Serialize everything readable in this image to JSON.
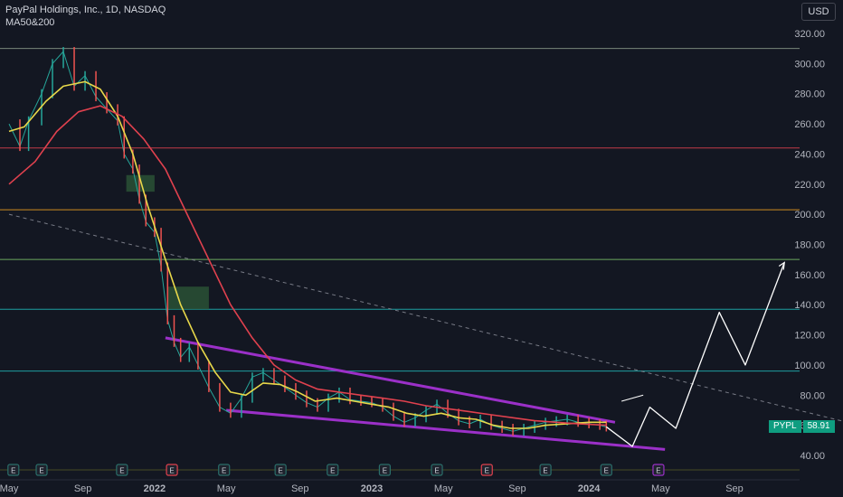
{
  "header": {
    "title": "PayPal Holdings, Inc., 1D, NASDAQ",
    "indicator": "MA50&200"
  },
  "currency_label": "USD",
  "price_badge": {
    "symbol": "PYPL",
    "value": "58.91"
  },
  "colors": {
    "background": "#131722",
    "grid_text": "#b2b5be",
    "ma50": "#e8d84a",
    "ma200": "#e0414e",
    "channel": "#9b30c8",
    "up": "#26a69a",
    "down": "#ef5350",
    "projection": "#ffffff",
    "badge": "#0f9d80"
  },
  "chart_data": {
    "type": "line",
    "title": "PayPal Holdings, Inc., 1D, NASDAQ",
    "subtitle": "MA50&200",
    "y_axis": {
      "ticks": [
        320,
        300,
        280,
        260,
        240,
        220,
        200,
        180,
        160,
        140,
        120,
        100,
        80,
        60,
        40
      ],
      "range": [
        30,
        330
      ]
    },
    "x_axis": {
      "range": [
        2020.38,
        2025.0
      ],
      "ticks": [
        {
          "label": "May",
          "x": 2020.33
        },
        {
          "label": "Sep",
          "x": 2020.67
        },
        {
          "label": "2022",
          "x": 2021.0
        },
        {
          "label": "May",
          "x": 2021.33
        },
        {
          "label": "Sep",
          "x": 2021.67
        },
        {
          "label": "2023",
          "x": 2022.0
        },
        {
          "label": "May",
          "x": 2022.33
        },
        {
          "label": "Sep",
          "x": 2022.67
        },
        {
          "label": "2024",
          "x": 2023.0
        },
        {
          "label": "May",
          "x": 2023.33
        },
        {
          "label": "Sep",
          "x": 2023.67
        }
      ]
    },
    "horizontal_levels": [
      {
        "value": 310,
        "color": "#8a9a8a"
      },
      {
        "value": 244,
        "color": "#e0414e"
      },
      {
        "value": 203,
        "color": "#f0a020"
      },
      {
        "value": 170,
        "color": "#7bc26a"
      },
      {
        "value": 137,
        "color": "#1fb5b5"
      },
      {
        "value": 96,
        "color": "#1fb5b5"
      }
    ],
    "series": [
      {
        "kind": "price",
        "points": [
          [
            2020.33,
            260
          ],
          [
            2020.38,
            245
          ],
          [
            2020.42,
            262
          ],
          [
            2020.48,
            280
          ],
          [
            2020.53,
            300
          ],
          [
            2020.58,
            308
          ],
          [
            2020.63,
            285
          ],
          [
            2020.68,
            292
          ],
          [
            2020.73,
            278
          ],
          [
            2020.78,
            270
          ],
          [
            2020.83,
            262
          ],
          [
            2020.86,
            240
          ],
          [
            2020.9,
            230
          ],
          [
            2020.93,
            210
          ],
          [
            2020.96,
            195
          ],
          [
            2021.0,
            188
          ],
          [
            2021.03,
            165
          ],
          [
            2021.06,
            130
          ],
          [
            2021.09,
            115
          ],
          [
            2021.12,
            105
          ],
          [
            2021.16,
            112
          ],
          [
            2021.2,
            100
          ],
          [
            2021.25,
            85
          ],
          [
            2021.3,
            72
          ],
          [
            2021.35,
            68
          ],
          [
            2021.4,
            78
          ],
          [
            2021.45,
            92
          ],
          [
            2021.5,
            95
          ],
          [
            2021.55,
            90
          ],
          [
            2021.6,
            85
          ],
          [
            2021.65,
            80
          ],
          [
            2021.7,
            75
          ],
          [
            2021.75,
            72
          ],
          [
            2021.8,
            78
          ],
          [
            2021.85,
            82
          ],
          [
            2021.9,
            77
          ],
          [
            2021.95,
            76
          ],
          [
            2022.0,
            75
          ],
          [
            2022.05,
            72
          ],
          [
            2022.1,
            66
          ],
          [
            2022.15,
            62
          ],
          [
            2022.2,
            65
          ],
          [
            2022.25,
            70
          ],
          [
            2022.3,
            74
          ],
          [
            2022.35,
            68
          ],
          [
            2022.4,
            63
          ],
          [
            2022.45,
            61
          ],
          [
            2022.5,
            64
          ],
          [
            2022.55,
            60
          ],
          [
            2022.6,
            58
          ],
          [
            2022.65,
            56
          ],
          [
            2022.7,
            58
          ],
          [
            2022.75,
            60
          ],
          [
            2022.8,
            62
          ],
          [
            2022.85,
            63
          ],
          [
            2022.9,
            64
          ],
          [
            2022.95,
            62
          ],
          [
            2023.0,
            61
          ],
          [
            2023.05,
            60
          ],
          [
            2023.08,
            58.91
          ]
        ]
      },
      {
        "kind": "ma50",
        "points": [
          [
            2020.33,
            255
          ],
          [
            2020.4,
            258
          ],
          [
            2020.5,
            275
          ],
          [
            2020.58,
            285
          ],
          [
            2020.68,
            288
          ],
          [
            2020.75,
            283
          ],
          [
            2020.83,
            265
          ],
          [
            2020.9,
            240
          ],
          [
            2020.97,
            205
          ],
          [
            2021.05,
            170
          ],
          [
            2021.12,
            140
          ],
          [
            2021.2,
            115
          ],
          [
            2021.28,
            95
          ],
          [
            2021.35,
            82
          ],
          [
            2021.42,
            80
          ],
          [
            2021.5,
            88
          ],
          [
            2021.58,
            87
          ],
          [
            2021.66,
            82
          ],
          [
            2021.74,
            76
          ],
          [
            2021.84,
            78
          ],
          [
            2021.92,
            76
          ],
          [
            2022.0,
            74
          ],
          [
            2022.08,
            72
          ],
          [
            2022.16,
            68
          ],
          [
            2022.24,
            66
          ],
          [
            2022.32,
            68
          ],
          [
            2022.4,
            65
          ],
          [
            2022.48,
            64
          ],
          [
            2022.56,
            60
          ],
          [
            2022.64,
            58
          ],
          [
            2022.72,
            58
          ],
          [
            2022.8,
            60
          ],
          [
            2022.9,
            61
          ],
          [
            2023.0,
            62
          ],
          [
            2023.08,
            62
          ]
        ]
      },
      {
        "kind": "ma200",
        "points": [
          [
            2020.33,
            220
          ],
          [
            2020.45,
            235
          ],
          [
            2020.55,
            255
          ],
          [
            2020.65,
            268
          ],
          [
            2020.75,
            272
          ],
          [
            2020.85,
            265
          ],
          [
            2020.95,
            250
          ],
          [
            2021.05,
            230
          ],
          [
            2021.15,
            200
          ],
          [
            2021.25,
            170
          ],
          [
            2021.35,
            140
          ],
          [
            2021.45,
            118
          ],
          [
            2021.55,
            100
          ],
          [
            2021.65,
            90
          ],
          [
            2021.75,
            84
          ],
          [
            2021.85,
            82
          ],
          [
            2021.95,
            80
          ],
          [
            2022.05,
            78
          ],
          [
            2022.15,
            76
          ],
          [
            2022.25,
            73
          ],
          [
            2022.35,
            71
          ],
          [
            2022.45,
            69
          ],
          [
            2022.55,
            67
          ],
          [
            2022.65,
            65
          ],
          [
            2022.75,
            63
          ],
          [
            2022.85,
            62
          ],
          [
            2022.95,
            61
          ],
          [
            2023.08,
            60
          ]
        ]
      },
      {
        "kind": "projection",
        "points": [
          [
            2023.08,
            59
          ],
          [
            2023.2,
            46
          ],
          [
            2023.28,
            72
          ],
          [
            2023.4,
            58
          ],
          [
            2023.6,
            135
          ],
          [
            2023.72,
            100
          ],
          [
            2023.9,
            168
          ]
        ]
      }
    ],
    "trendlines": [
      {
        "kind": "channel_top",
        "from": [
          2021.05,
          118
        ],
        "to": [
          2023.12,
          62
        ]
      },
      {
        "kind": "channel_bottom",
        "from": [
          2021.33,
          70
        ],
        "to": [
          2023.35,
          44
        ]
      },
      {
        "kind": "dashed",
        "from": [
          2020.33,
          200
        ],
        "to": [
          2025.0,
          33
        ]
      }
    ],
    "zones": [
      {
        "x0": 2020.87,
        "x1": 2021.0,
        "y0": 215,
        "y1": 226
      },
      {
        "x0": 2021.06,
        "x1": 2021.25,
        "y0": 137,
        "y1": 152
      }
    ],
    "event_markers": [
      {
        "label": "E",
        "x": 2020.35,
        "kind": "past"
      },
      {
        "label": "E",
        "x": 2020.48,
        "kind": "past"
      },
      {
        "label": "E",
        "x": 2020.85,
        "kind": "past"
      },
      {
        "label": "E",
        "x": 2021.08,
        "kind": "negative"
      },
      {
        "label": "E",
        "x": 2021.32,
        "kind": "past"
      },
      {
        "label": "E",
        "x": 2021.58,
        "kind": "past"
      },
      {
        "label": "E",
        "x": 2021.82,
        "kind": "past"
      },
      {
        "label": "E",
        "x": 2022.06,
        "kind": "past"
      },
      {
        "label": "E",
        "x": 2022.3,
        "kind": "past"
      },
      {
        "label": "E",
        "x": 2022.53,
        "kind": "negative"
      },
      {
        "label": "E",
        "x": 2022.8,
        "kind": "past"
      },
      {
        "label": "E",
        "x": 2023.08,
        "kind": "past"
      },
      {
        "label": "E",
        "x": 2023.32,
        "kind": "future"
      }
    ]
  }
}
